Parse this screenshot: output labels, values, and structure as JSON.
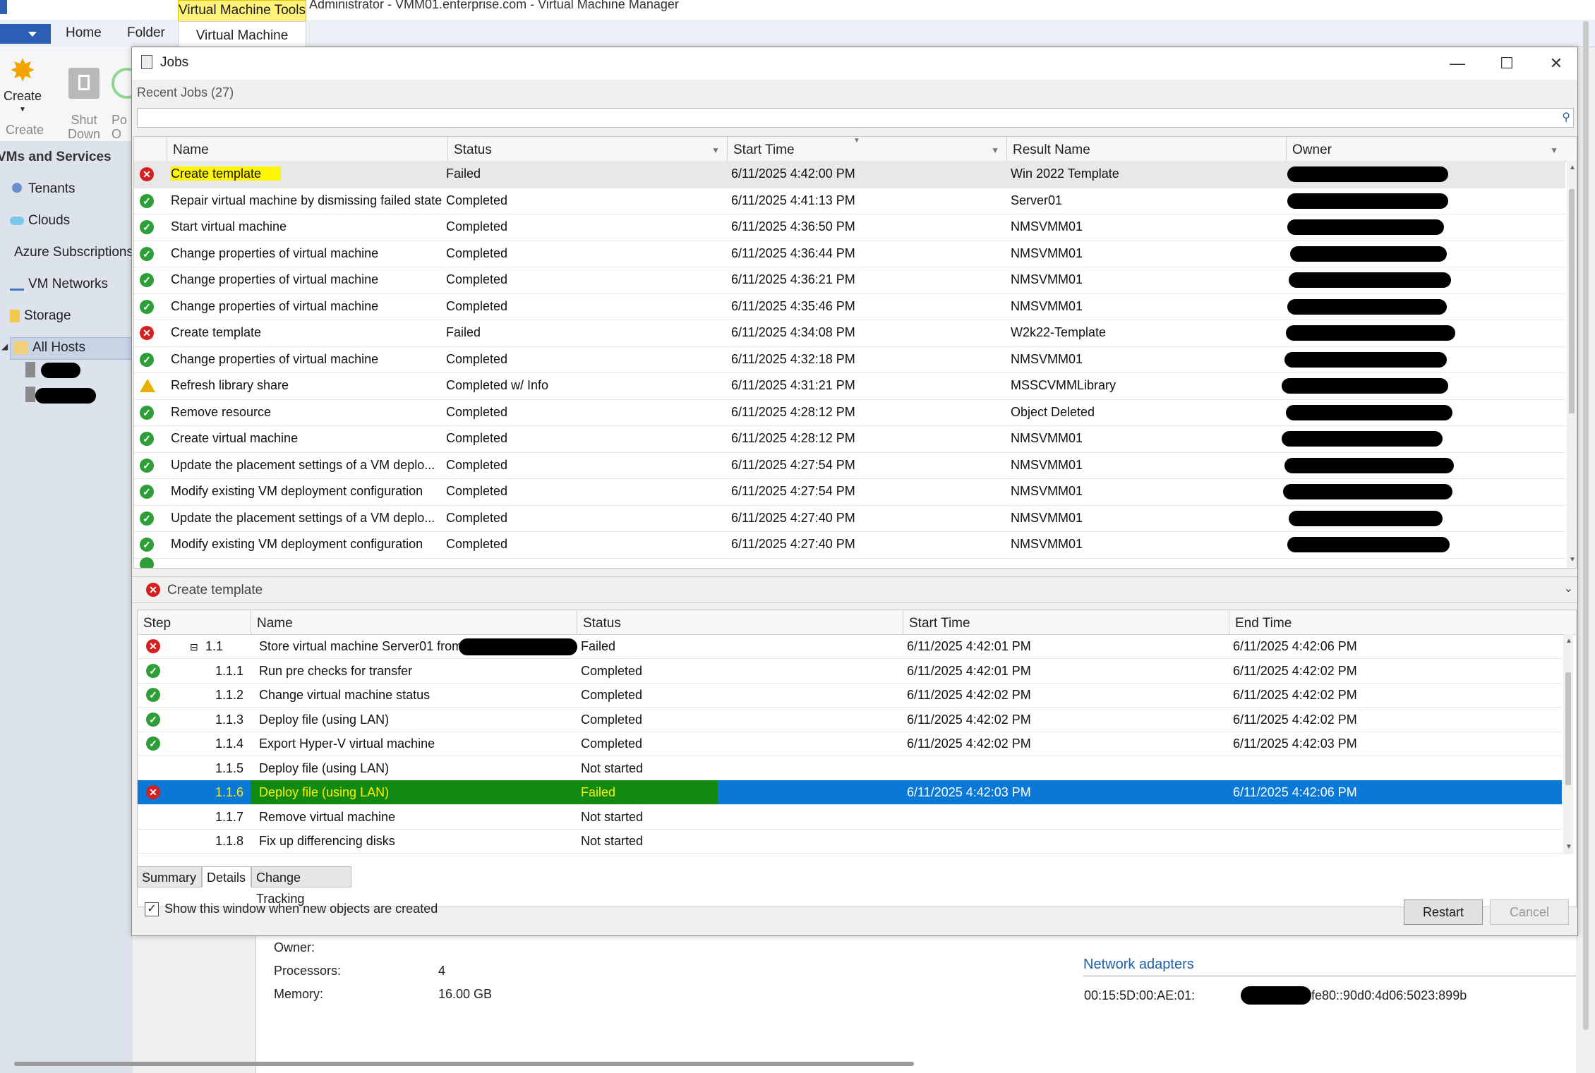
{
  "app": {
    "title": "Administrator - VMM01.enterprise.com - Virtual Machine Manager",
    "contextual_tab_group": "Virtual Machine Tools",
    "ribbon_tabs": [
      "Home",
      "Folder",
      "Virtual Machine"
    ],
    "ribbon_buttons": {
      "create": "Create",
      "shut_down": "Shut\nDown",
      "power_on": "Po\nO"
    },
    "ribbon_group_label": "Create"
  },
  "nav": {
    "header": "VMs and Services",
    "items": [
      {
        "label": "Tenants",
        "icon": "tenants-icon"
      },
      {
        "label": "Clouds",
        "icon": "cloud-icon"
      },
      {
        "label": "Azure Subscriptions",
        "icon": "azure-icon"
      },
      {
        "label": "VM Networks",
        "icon": "network-icon"
      },
      {
        "label": "Storage",
        "icon": "storage-icon"
      },
      {
        "label": "All Hosts",
        "icon": "folder-icon"
      }
    ]
  },
  "jobs_window": {
    "title": "Jobs",
    "recent_label": "Recent Jobs (27)",
    "search_placeholder": "",
    "columns": [
      "Name",
      "Status",
      "Start Time",
      "Result Name",
      "Owner"
    ],
    "rows": [
      {
        "status_icon": "fail",
        "name": "Create template",
        "status": "Failed",
        "start": "6/11/2025 4:42:00 PM",
        "result": "Win 2022 Template"
      },
      {
        "status_icon": "ok",
        "name": "Repair virtual machine by dismissing failed state",
        "status": "Completed",
        "start": "6/11/2025 4:41:13 PM",
        "result": "Server01"
      },
      {
        "status_icon": "ok",
        "name": "Start virtual machine",
        "status": "Completed",
        "start": "6/11/2025 4:36:50 PM",
        "result": "NMSVMM01"
      },
      {
        "status_icon": "ok",
        "name": "Change properties of virtual machine",
        "status": "Completed",
        "start": "6/11/2025 4:36:44 PM",
        "result": "NMSVMM01"
      },
      {
        "status_icon": "ok",
        "name": "Change properties of virtual machine",
        "status": "Completed",
        "start": "6/11/2025 4:36:21 PM",
        "result": "NMSVMM01"
      },
      {
        "status_icon": "ok",
        "name": "Change properties of virtual machine",
        "status": "Completed",
        "start": "6/11/2025 4:35:46 PM",
        "result": "NMSVMM01"
      },
      {
        "status_icon": "fail",
        "name": "Create template",
        "status": "Failed",
        "start": "6/11/2025 4:34:08 PM",
        "result": "W2k22-Template"
      },
      {
        "status_icon": "ok",
        "name": "Change properties of virtual machine",
        "status": "Completed",
        "start": "6/11/2025 4:32:18 PM",
        "result": "NMSVMM01"
      },
      {
        "status_icon": "warn",
        "name": "Refresh library share",
        "status": "Completed w/ Info",
        "start": "6/11/2025 4:31:21 PM",
        "result": "MSSCVMMLibrary"
      },
      {
        "status_icon": "ok",
        "name": "Remove resource",
        "status": "Completed",
        "start": "6/11/2025 4:28:12 PM",
        "result": "Object Deleted"
      },
      {
        "status_icon": "ok",
        "name": "Create virtual machine",
        "status": "Completed",
        "start": "6/11/2025 4:28:12 PM",
        "result": "NMSVMM01"
      },
      {
        "status_icon": "ok",
        "name": "Update the placement settings of a VM deplo...",
        "status": "Completed",
        "start": "6/11/2025 4:27:54 PM",
        "result": "NMSVMM01"
      },
      {
        "status_icon": "ok",
        "name": "Modify existing VM deployment configuration",
        "status": "Completed",
        "start": "6/11/2025 4:27:54 PM",
        "result": "NMSVMM01"
      },
      {
        "status_icon": "ok",
        "name": "Update the placement settings of a VM deplo...",
        "status": "Completed",
        "start": "6/11/2025 4:27:40 PM",
        "result": "NMSVMM01"
      },
      {
        "status_icon": "ok",
        "name": "Modify existing VM deployment configuration",
        "status": "Completed",
        "start": "6/11/2025 4:27:40 PM",
        "result": "NMSVMM01"
      }
    ],
    "detail_title": "Create template",
    "step_columns": [
      "Step",
      "Name",
      "Status",
      "Start Time",
      "End Time"
    ],
    "steps": [
      {
        "status_icon": "fail",
        "step": "1.1",
        "name": "Store virtual machine Server01 from",
        "status": "Failed",
        "start": "6/11/2025 4:42:01 PM",
        "end": "6/11/2025 4:42:06 PM",
        "expander": "⊟"
      },
      {
        "status_icon": "ok",
        "step": "1.1.1",
        "name": "Run pre checks for transfer",
        "status": "Completed",
        "start": "6/11/2025 4:42:01 PM",
        "end": "6/11/2025 4:42:02 PM"
      },
      {
        "status_icon": "ok",
        "step": "1.1.2",
        "name": "Change virtual machine status",
        "status": "Completed",
        "start": "6/11/2025 4:42:02 PM",
        "end": "6/11/2025 4:42:02 PM"
      },
      {
        "status_icon": "ok",
        "step": "1.1.3",
        "name": "Deploy file (using LAN)",
        "status": "Completed",
        "start": "6/11/2025 4:42:02 PM",
        "end": "6/11/2025 4:42:02 PM"
      },
      {
        "status_icon": "ok",
        "step": "1.1.4",
        "name": "Export Hyper-V virtual machine",
        "status": "Completed",
        "start": "6/11/2025 4:42:02 PM",
        "end": "6/11/2025 4:42:03 PM"
      },
      {
        "status_icon": "none",
        "step": "1.1.5",
        "name": "Deploy file (using LAN)",
        "status": "Not started",
        "start": "",
        "end": ""
      },
      {
        "status_icon": "fail",
        "step": "1.1.6",
        "name": "Deploy file (using LAN)",
        "status": "Failed",
        "start": "6/11/2025 4:42:03 PM",
        "end": "6/11/2025 4:42:06 PM"
      },
      {
        "status_icon": "none",
        "step": "1.1.7",
        "name": "Remove virtual machine",
        "status": "Not started",
        "start": "",
        "end": ""
      },
      {
        "status_icon": "none",
        "step": "1.1.8",
        "name": "Fix up differencing disks",
        "status": "Not started",
        "start": "",
        "end": ""
      }
    ],
    "tabs": [
      "Summary",
      "Details",
      "Change Tracking"
    ],
    "show_window_label": "Show this window when new objects are created",
    "show_window_checked": true,
    "restart_label": "Restart",
    "cancel_label": "Cancel"
  },
  "vm_details": {
    "owner_label": "Owner:",
    "processors_label": "Processors:",
    "processors_value": "4",
    "memory_label": "Memory:",
    "memory_value": "16.00 GB",
    "network_header": "Network adapters",
    "mac": "00:15:5D:00:AE:01:",
    "ipv6": "fe80::90d0:4d06:5023:899b"
  },
  "colors": {
    "accent": "#0a78d6",
    "highlight": "#fff700",
    "ok": "#2e9e38",
    "fail": "#d42020",
    "warn": "#e8b000"
  }
}
